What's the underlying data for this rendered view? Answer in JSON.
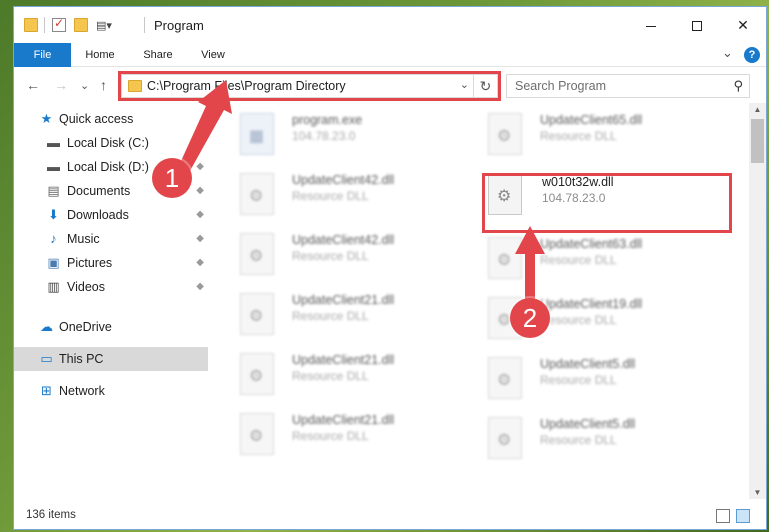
{
  "window": {
    "title": "Program",
    "buttons": {
      "minimize": "—",
      "maximize": "",
      "close": "✕"
    }
  },
  "ribbon": {
    "tabs": [
      "File",
      "Home",
      "Share",
      "View"
    ],
    "expand": "⌄",
    "help": "?"
  },
  "nav": {
    "back": "←",
    "forward": "→",
    "recent": "⌄",
    "up": "↑",
    "address": "C:\\Program Files\\Program Directory",
    "address_drop": "⌄",
    "refresh": "↻",
    "search_placeholder": "Search Program",
    "search_icon": "⚲"
  },
  "sidebar": {
    "items": [
      {
        "label": "Quick access",
        "icon": "star-icon",
        "glyph": "★"
      },
      {
        "label": "Local Disk (C:)",
        "icon": "drive-icon",
        "glyph": "▬"
      },
      {
        "label": "Local Disk (D:)",
        "icon": "drive-icon",
        "glyph": "▬"
      },
      {
        "label": "Documents",
        "icon": "documents-icon",
        "glyph": "▤"
      },
      {
        "label": "Downloads",
        "icon": "download-icon",
        "glyph": "⬇"
      },
      {
        "label": "Music",
        "icon": "music-icon",
        "glyph": "♪"
      },
      {
        "label": "Pictures",
        "icon": "pictures-icon",
        "glyph": "▣"
      },
      {
        "label": "Videos",
        "icon": "videos-icon",
        "glyph": "▥"
      },
      {
        "label": "OneDrive",
        "icon": "cloud-icon",
        "glyph": "☁"
      },
      {
        "label": "This PC",
        "icon": "computer-icon",
        "glyph": "▭"
      },
      {
        "label": "Network",
        "icon": "network-icon",
        "glyph": "⊞"
      }
    ],
    "pin": "📌"
  },
  "files": [
    {
      "name": "program.exe",
      "sub": "104.78.23.0"
    },
    {
      "name": "UpdateClient65.dll",
      "sub": "Resource DLL"
    },
    {
      "name": "UpdateClient42.dll",
      "sub": "Resource DLL"
    },
    {
      "name": "w010t32w.dll",
      "sub": "104.78.23.0"
    },
    {
      "name": "UpdateClient42.dll",
      "sub": "Resource DLL"
    },
    {
      "name": "UpdateClient63.dll",
      "sub": "Resource DLL"
    },
    {
      "name": "UpdateClient21.dll",
      "sub": "Resource DLL"
    },
    {
      "name": "UpdateClient19.dll",
      "sub": "Resource DLL"
    },
    {
      "name": "UpdateClient21.dll",
      "sub": "Resource DLL"
    },
    {
      "name": "UpdateClient5.dll",
      "sub": "Resource DLL"
    },
    {
      "name": "UpdateClient21.dll",
      "sub": "Resource DLL"
    },
    {
      "name": "UpdateClient5.dll",
      "sub": "Resource DLL"
    }
  ],
  "status": {
    "items": "136 items"
  },
  "annotations": {
    "step1": "1",
    "step2": "2"
  },
  "colors": {
    "accent": "#1979ca",
    "annotation": "#e2464a",
    "selected": "#d9d9d9"
  }
}
